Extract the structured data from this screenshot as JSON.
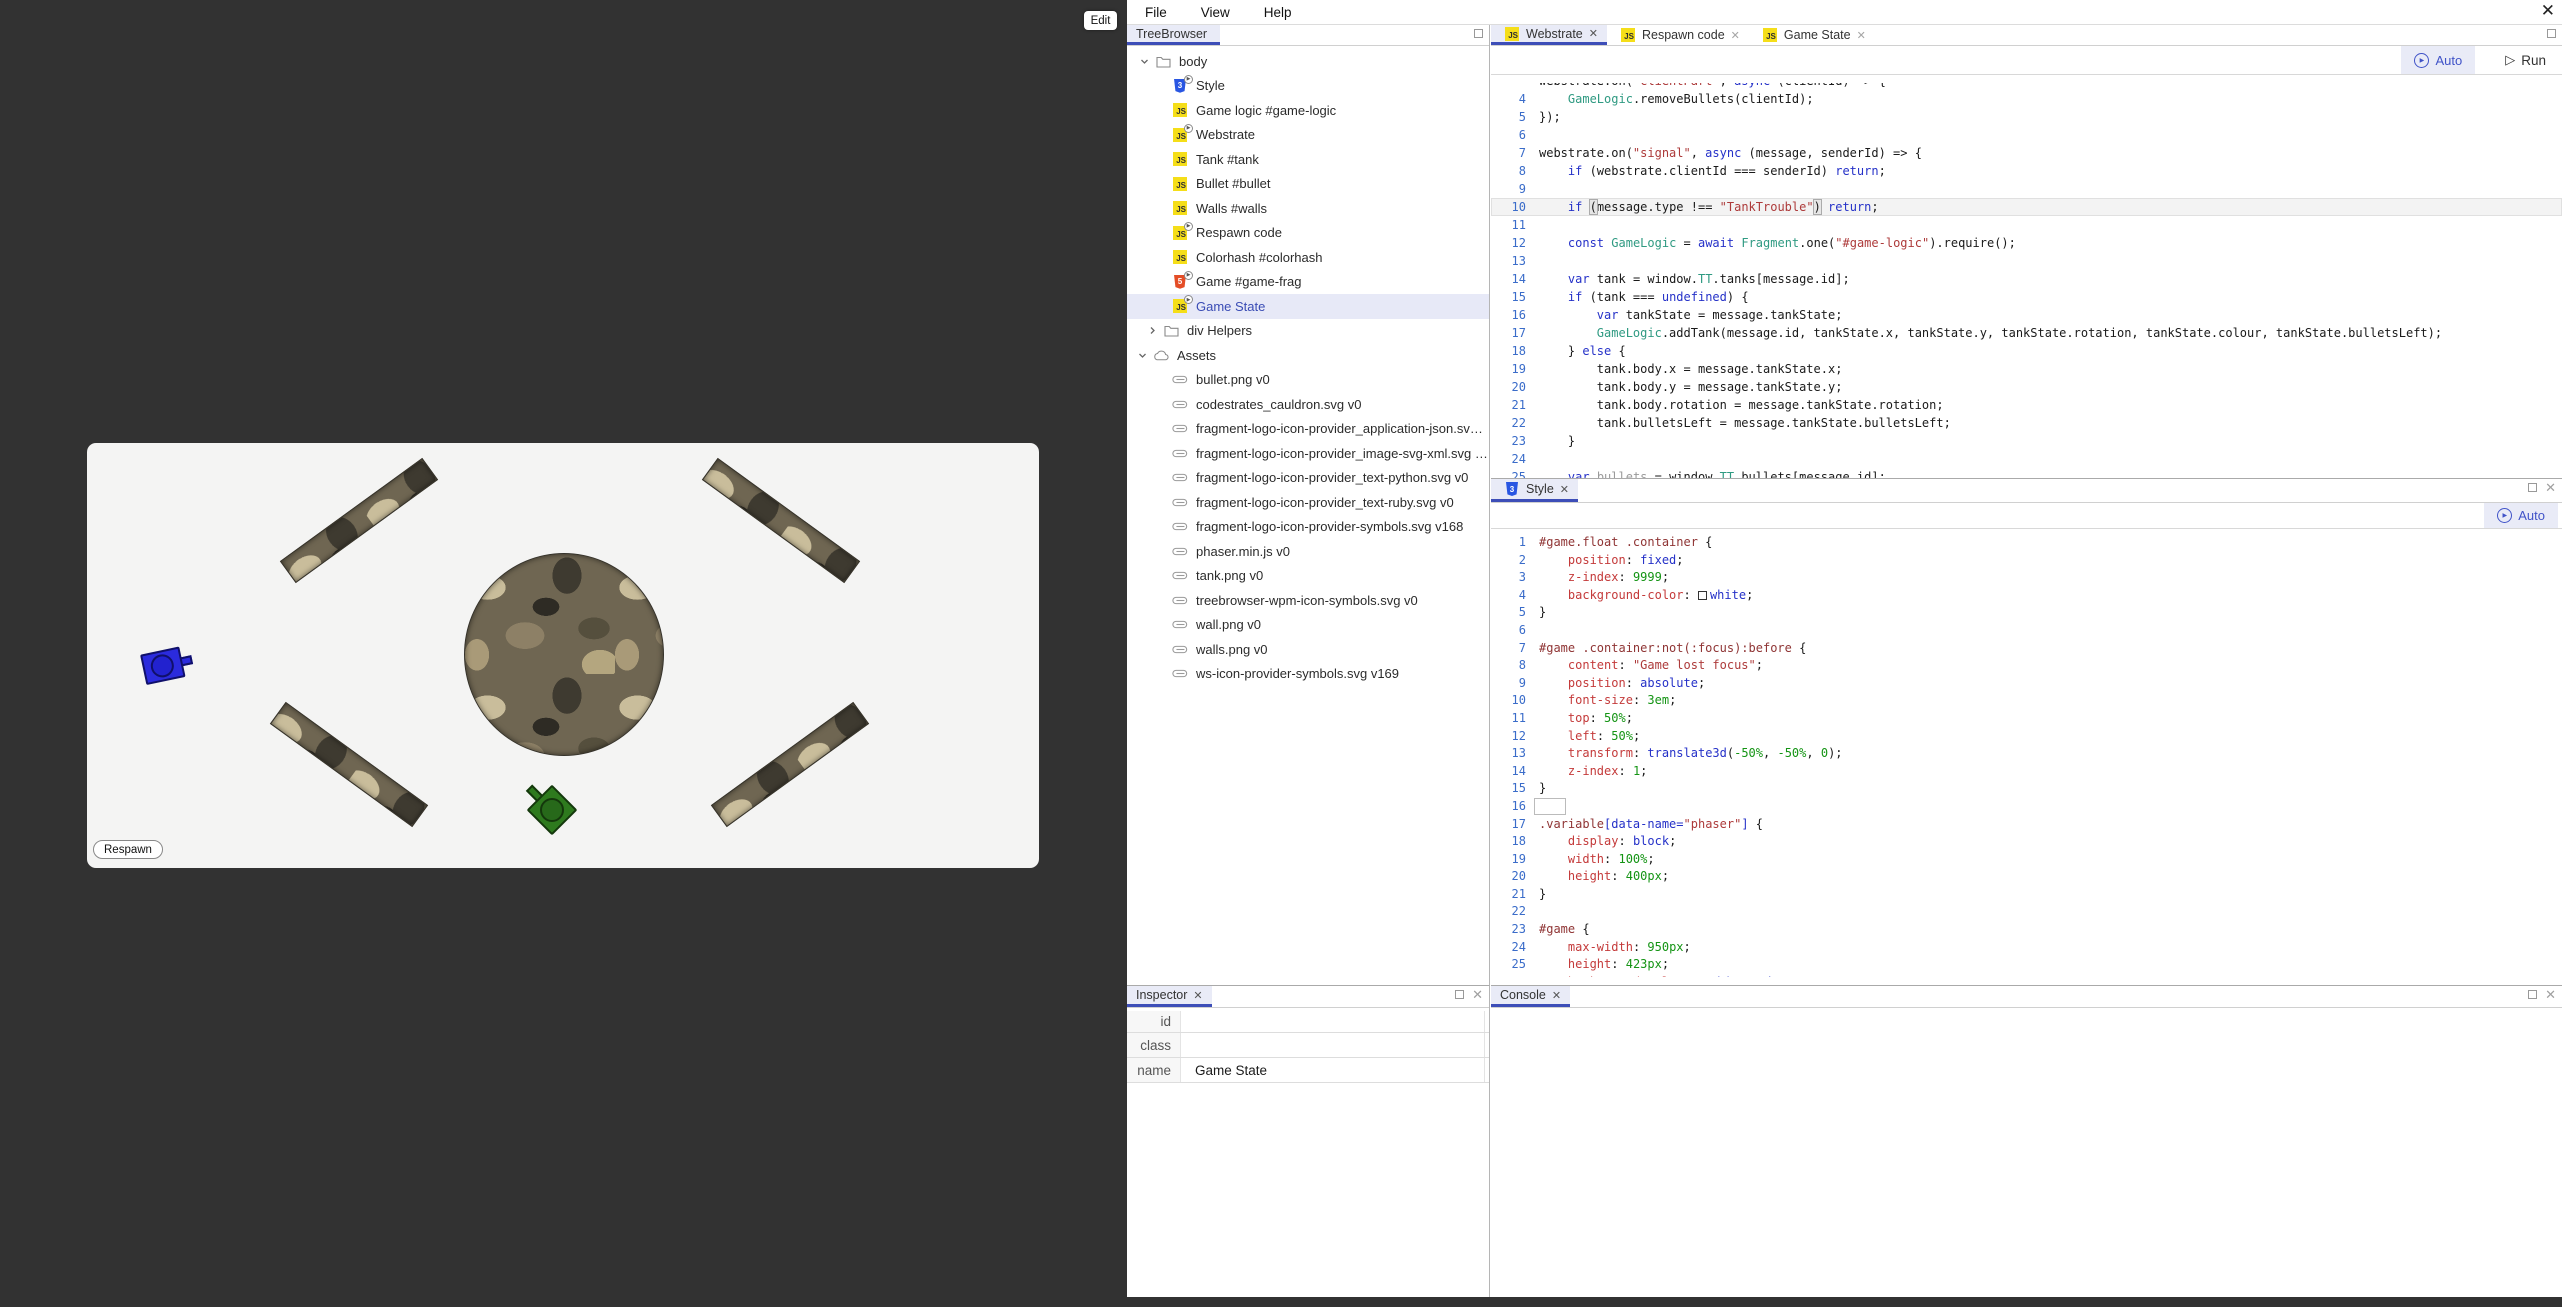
{
  "icons": {
    "close": "✕",
    "play": "▶",
    "run_triangle": "▷"
  },
  "edit_button": {
    "label": "Edit"
  },
  "menu": {
    "items": [
      "File",
      "View",
      "Help"
    ]
  },
  "game": {
    "respawn_label": "Respawn",
    "tank_colors": {
      "blue": "#2b2bdd",
      "green": "#2e7a1e"
    },
    "canvas_bg": "#f4f4f3"
  },
  "treebrowser": {
    "tab": "TreeBrowser",
    "nodes": [
      {
        "pad": 10,
        "chevron": "down",
        "icon": "folder",
        "label": "body"
      },
      {
        "pad": 41,
        "icon": "css",
        "badge": true,
        "label": "Style"
      },
      {
        "pad": 41,
        "icon": "js",
        "badge": false,
        "label": "Game logic #game-logic"
      },
      {
        "pad": 41,
        "icon": "js",
        "badge": true,
        "label": "Webstrate"
      },
      {
        "pad": 41,
        "icon": "js",
        "badge": false,
        "label": "Tank #tank"
      },
      {
        "pad": 41,
        "icon": "js",
        "badge": false,
        "label": "Bullet #bullet"
      },
      {
        "pad": 41,
        "icon": "js",
        "badge": false,
        "label": "Walls #walls"
      },
      {
        "pad": 41,
        "icon": "js",
        "badge": true,
        "label": "Respawn code"
      },
      {
        "pad": 41,
        "icon": "js",
        "badge": false,
        "label": "Colorhash #colorhash"
      },
      {
        "pad": 41,
        "icon": "html",
        "badge": true,
        "label": "Game #game-frag"
      },
      {
        "pad": 41,
        "icon": "js",
        "badge": true,
        "label": "Game State",
        "selected": true
      },
      {
        "pad": 18,
        "chevron": "right",
        "icon": "folder",
        "label": "div Helpers"
      },
      {
        "pad": 8,
        "chevron": "down",
        "icon": "cloud",
        "label": "Assets"
      },
      {
        "pad": 41,
        "icon": "attachment",
        "label": "bullet.png v0"
      },
      {
        "pad": 41,
        "icon": "attachment",
        "label": "codestrates_cauldron.svg v0"
      },
      {
        "pad": 41,
        "icon": "attachment",
        "label": "fragment-logo-icon-provider_application-json.sv…"
      },
      {
        "pad": 41,
        "icon": "attachment",
        "label": "fragment-logo-icon-provider_image-svg-xml.svg …"
      },
      {
        "pad": 41,
        "icon": "attachment",
        "label": "fragment-logo-icon-provider_text-python.svg v0"
      },
      {
        "pad": 41,
        "icon": "attachment",
        "label": "fragment-logo-icon-provider_text-ruby.svg v0"
      },
      {
        "pad": 41,
        "icon": "attachment",
        "label": "fragment-logo-icon-provider-symbols.svg v168"
      },
      {
        "pad": 41,
        "icon": "attachment",
        "label": "phaser.min.js v0"
      },
      {
        "pad": 41,
        "icon": "attachment",
        "label": "tank.png v0"
      },
      {
        "pad": 41,
        "icon": "attachment",
        "label": "treebrowser-wpm-icon-symbols.svg v0"
      },
      {
        "pad": 41,
        "icon": "attachment",
        "label": "wall.png v0"
      },
      {
        "pad": 41,
        "icon": "attachment",
        "label": "walls.png v0"
      },
      {
        "pad": 41,
        "icon": "attachment",
        "label": "ws-icon-provider-symbols.svg v169"
      }
    ]
  },
  "editor": {
    "tabs": [
      {
        "label": "Webstrate",
        "active": true
      },
      {
        "label": "Respawn code",
        "active": false
      },
      {
        "label": "Game State",
        "active": false
      }
    ],
    "auto_label": "Auto",
    "run_label": "Run",
    "clip_line": [
      [
        "d",
        "webstrate.on("
      ],
      [
        "s",
        "\"clientPart\""
      ],
      [
        "d",
        ", "
      ],
      [
        "k",
        "async"
      ],
      [
        "d",
        " (clientId) => {"
      ]
    ],
    "lines": [
      {
        "n": 4,
        "t": [
          [
            "d",
            "    "
          ],
          [
            "v",
            "GameLogic"
          ],
          [
            "d",
            ".removeBullets(clientId);"
          ]
        ]
      },
      {
        "n": 5,
        "t": [
          [
            "d",
            "});"
          ]
        ]
      },
      {
        "n": 6,
        "t": []
      },
      {
        "n": 7,
        "t": [
          [
            "d",
            "webstrate.on("
          ],
          [
            "s",
            "\"signal\""
          ],
          [
            "d",
            ", "
          ],
          [
            "k",
            "async"
          ],
          [
            "d",
            " (message, senderId) => {"
          ]
        ]
      },
      {
        "n": 8,
        "t": [
          [
            "d",
            "    "
          ],
          [
            "k",
            "if"
          ],
          [
            "d",
            " (webstrate.clientId === senderId) "
          ],
          [
            "k",
            "return"
          ],
          [
            "d",
            ";"
          ]
        ]
      },
      {
        "n": 9,
        "t": []
      },
      {
        "n": 10,
        "active": true,
        "t": [
          [
            "d",
            "    "
          ],
          [
            "k",
            "if"
          ],
          [
            "d",
            " "
          ],
          [
            "m",
            "("
          ],
          [
            "d",
            "message.type !== "
          ],
          [
            "s",
            "\"TankTrouble\""
          ],
          [
            "m",
            ")"
          ],
          [
            "d",
            " "
          ],
          [
            "k",
            "return"
          ],
          [
            "d",
            ";"
          ]
        ]
      },
      {
        "n": 11,
        "t": []
      },
      {
        "n": 12,
        "t": [
          [
            "d",
            "    "
          ],
          [
            "k",
            "const"
          ],
          [
            "d",
            " "
          ],
          [
            "v",
            "GameLogic"
          ],
          [
            "d",
            " = "
          ],
          [
            "k",
            "await"
          ],
          [
            "d",
            " "
          ],
          [
            "v",
            "Fragment"
          ],
          [
            "d",
            ".one("
          ],
          [
            "s",
            "\"#game-logic\""
          ],
          [
            "d",
            ").require();"
          ]
        ]
      },
      {
        "n": 13,
        "t": []
      },
      {
        "n": 14,
        "t": [
          [
            "d",
            "    "
          ],
          [
            "k",
            "var"
          ],
          [
            "d",
            " tank = window."
          ],
          [
            "v",
            "TT"
          ],
          [
            "d",
            ".tanks[message.id];"
          ]
        ]
      },
      {
        "n": 15,
        "t": [
          [
            "d",
            "    "
          ],
          [
            "k",
            "if"
          ],
          [
            "d",
            " (tank === "
          ],
          [
            "k",
            "undefined"
          ],
          [
            "d",
            ") {"
          ]
        ]
      },
      {
        "n": 16,
        "t": [
          [
            "d",
            "        "
          ],
          [
            "k",
            "var"
          ],
          [
            "d",
            " tankState = message.tankState;"
          ]
        ]
      },
      {
        "n": 17,
        "t": [
          [
            "d",
            "        "
          ],
          [
            "v",
            "GameLogic"
          ],
          [
            "d",
            ".addTank(message.id, tankState.x, tankState.y, tankState.rotation, tankState.colour, tankState.bulletsLeft);"
          ]
        ]
      },
      {
        "n": 18,
        "t": [
          [
            "d",
            "    } "
          ],
          [
            "k",
            "else"
          ],
          [
            "d",
            " {"
          ]
        ]
      },
      {
        "n": 19,
        "t": [
          [
            "d",
            "        tank.body.x = message.tankState.x;"
          ]
        ]
      },
      {
        "n": 20,
        "t": [
          [
            "d",
            "        tank.body.y = message.tankState.y;"
          ]
        ]
      },
      {
        "n": 21,
        "t": [
          [
            "d",
            "        tank.body.rotation = message.tankState.rotation;"
          ]
        ]
      },
      {
        "n": 22,
        "t": [
          [
            "d",
            "        tank.bulletsLeft = message.tankState.bulletsLeft;"
          ]
        ]
      },
      {
        "n": 23,
        "t": [
          [
            "d",
            "    }"
          ]
        ]
      },
      {
        "n": 24,
        "t": []
      },
      {
        "n": 25,
        "t": [
          [
            "d",
            "    "
          ],
          [
            "k",
            "var"
          ],
          [
            "d",
            " "
          ],
          [
            "c",
            "bullets"
          ],
          [
            "d",
            " = window."
          ],
          [
            "v",
            "TT"
          ],
          [
            "d",
            ".bullets[message.id];"
          ]
        ]
      }
    ]
  },
  "style_editor": {
    "tab": "Style",
    "auto_label": "Auto",
    "lines": [
      {
        "n": 1,
        "t": [
          [
            "sel",
            "#game.float .container"
          ],
          [
            "d",
            " {"
          ]
        ]
      },
      {
        "n": 2,
        "t": [
          [
            "d",
            "    "
          ],
          [
            "p",
            "position"
          ],
          [
            "d",
            ": "
          ],
          [
            "val",
            "fixed"
          ],
          [
            "d",
            ";"
          ]
        ]
      },
      {
        "n": 3,
        "t": [
          [
            "d",
            "    "
          ],
          [
            "p",
            "z-index"
          ],
          [
            "d",
            ": "
          ],
          [
            "num",
            "9999"
          ],
          [
            "d",
            ";"
          ]
        ]
      },
      {
        "n": 4,
        "t": [
          [
            "d",
            "    "
          ],
          [
            "p",
            "background-color"
          ],
          [
            "d",
            ": "
          ],
          [
            "swatch",
            "#ffffff"
          ],
          [
            "val",
            "white"
          ],
          [
            "d",
            ";"
          ]
        ]
      },
      {
        "n": 5,
        "t": [
          [
            "d",
            "}"
          ]
        ]
      },
      {
        "n": 6,
        "t": []
      },
      {
        "n": 7,
        "t": [
          [
            "sel",
            "#game .container:not(:focus):before"
          ],
          [
            "d",
            " {"
          ]
        ]
      },
      {
        "n": 8,
        "t": [
          [
            "d",
            "    "
          ],
          [
            "p",
            "content"
          ],
          [
            "d",
            ": "
          ],
          [
            "s",
            "\"Game lost focus\""
          ],
          [
            "d",
            ";"
          ]
        ]
      },
      {
        "n": 9,
        "t": [
          [
            "d",
            "    "
          ],
          [
            "p",
            "position"
          ],
          [
            "d",
            ": "
          ],
          [
            "val",
            "absolute"
          ],
          [
            "d",
            ";"
          ]
        ]
      },
      {
        "n": 10,
        "t": [
          [
            "d",
            "    "
          ],
          [
            "p",
            "font-size"
          ],
          [
            "d",
            ": "
          ],
          [
            "num",
            "3em"
          ],
          [
            "d",
            ";"
          ]
        ]
      },
      {
        "n": 11,
        "t": [
          [
            "d",
            "    "
          ],
          [
            "p",
            "top"
          ],
          [
            "d",
            ": "
          ],
          [
            "num",
            "50%"
          ],
          [
            "d",
            ";"
          ]
        ]
      },
      {
        "n": 12,
        "t": [
          [
            "d",
            "    "
          ],
          [
            "p",
            "left"
          ],
          [
            "d",
            ": "
          ],
          [
            "num",
            "50%"
          ],
          [
            "d",
            ";"
          ]
        ]
      },
      {
        "n": 13,
        "t": [
          [
            "d",
            "    "
          ],
          [
            "p",
            "transform"
          ],
          [
            "d",
            ": "
          ],
          [
            "val",
            "translate3d"
          ],
          [
            "d",
            "("
          ],
          [
            "num",
            "-50%"
          ],
          [
            "d",
            ", "
          ],
          [
            "num",
            "-50%"
          ],
          [
            "d",
            ", "
          ],
          [
            "num",
            "0"
          ],
          [
            "d",
            ");"
          ]
        ]
      },
      {
        "n": 14,
        "t": [
          [
            "d",
            "    "
          ],
          [
            "p",
            "z-index"
          ],
          [
            "d",
            ": "
          ],
          [
            "num",
            "1"
          ],
          [
            "d",
            ";"
          ]
        ]
      },
      {
        "n": 15,
        "t": [
          [
            "d",
            "}"
          ]
        ]
      },
      {
        "n": 16,
        "cursor": true,
        "t": []
      },
      {
        "n": 17,
        "t": [
          [
            "sel",
            ".variable"
          ],
          [
            "attr",
            "[data-name="
          ],
          [
            "s",
            "\"phaser\""
          ],
          [
            "attr",
            "]"
          ],
          [
            "d",
            " {"
          ]
        ]
      },
      {
        "n": 18,
        "t": [
          [
            "d",
            "    "
          ],
          [
            "p",
            "display"
          ],
          [
            "d",
            ": "
          ],
          [
            "val",
            "block"
          ],
          [
            "d",
            ";"
          ]
        ]
      },
      {
        "n": 19,
        "t": [
          [
            "d",
            "    "
          ],
          [
            "p",
            "width"
          ],
          [
            "d",
            ": "
          ],
          [
            "num",
            "100%"
          ],
          [
            "d",
            ";"
          ]
        ]
      },
      {
        "n": 20,
        "t": [
          [
            "d",
            "    "
          ],
          [
            "p",
            "height"
          ],
          [
            "d",
            ": "
          ],
          [
            "num",
            "400px"
          ],
          [
            "d",
            ";"
          ]
        ]
      },
      {
        "n": 21,
        "t": [
          [
            "d",
            "}"
          ]
        ]
      },
      {
        "n": 22,
        "t": []
      },
      {
        "n": 23,
        "t": [
          [
            "sel",
            "#game"
          ],
          [
            "d",
            " {"
          ]
        ]
      },
      {
        "n": 24,
        "t": [
          [
            "d",
            "    "
          ],
          [
            "p",
            "max-width"
          ],
          [
            "d",
            ": "
          ],
          [
            "num",
            "950px"
          ],
          [
            "d",
            ";"
          ]
        ]
      },
      {
        "n": 25,
        "t": [
          [
            "d",
            "    "
          ],
          [
            "p",
            "height"
          ],
          [
            "d",
            ": "
          ],
          [
            "num",
            "423px"
          ],
          [
            "d",
            ";"
          ]
        ]
      },
      {
        "n": 26,
        "t": [
          [
            "d",
            "    "
          ],
          [
            "p",
            "background-color"
          ],
          [
            "d",
            ": "
          ],
          [
            "swatch",
            "#f5f5f5"
          ],
          [
            "val",
            "whitesmoke"
          ],
          [
            "d",
            ";"
          ]
        ]
      }
    ]
  },
  "inspector": {
    "tab": "Inspector",
    "rows": [
      {
        "label": "id",
        "value": ""
      },
      {
        "label": "class",
        "value": ""
      },
      {
        "label": "name",
        "value": "Game State"
      }
    ]
  },
  "console": {
    "tab": "Console"
  }
}
